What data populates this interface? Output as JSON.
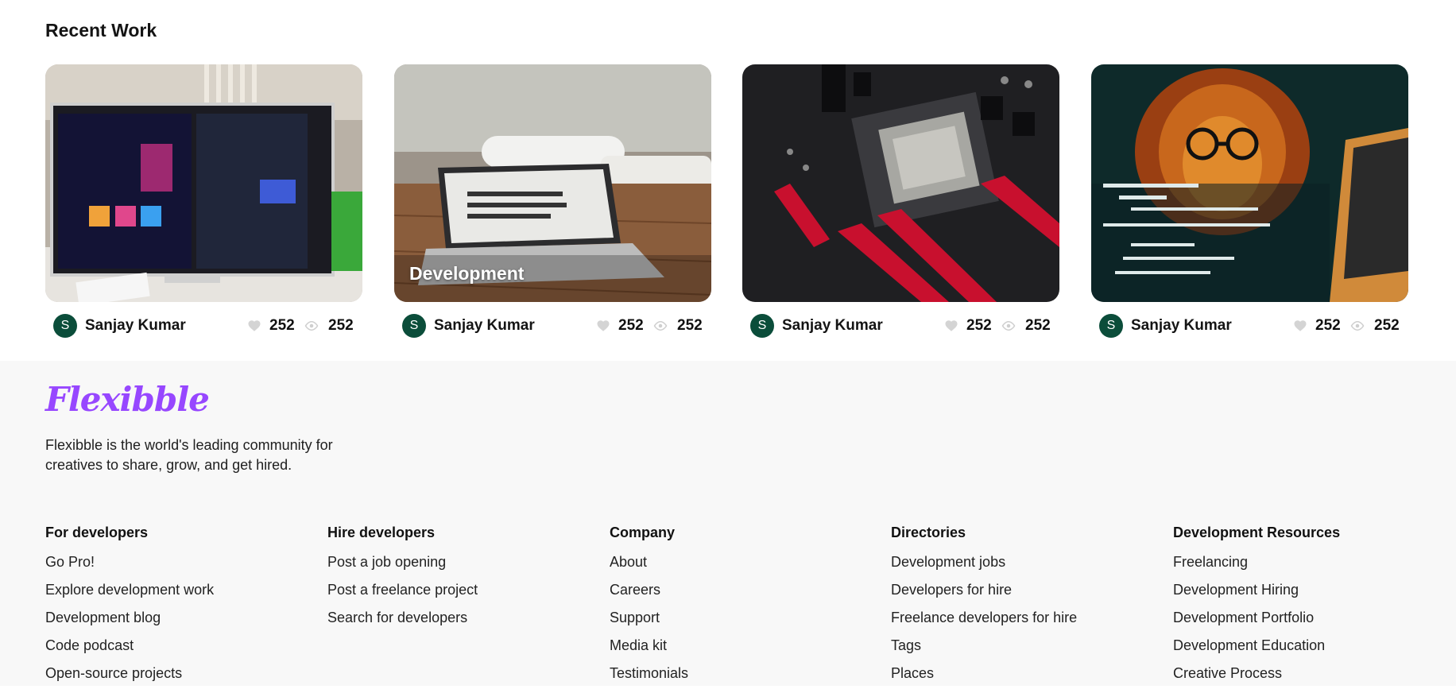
{
  "recent": {
    "title": "Recent Work",
    "cards": [
      {
        "overlay": "",
        "author": "Sanjay Kumar",
        "avatar_initial": "S",
        "likes": "252",
        "views": "252",
        "image": "monitor-design-photo"
      },
      {
        "overlay": "Development",
        "author": "Sanjay Kumar",
        "avatar_initial": "S",
        "likes": "252",
        "views": "252",
        "image": "laptop-desk-photo"
      },
      {
        "overlay": "",
        "author": "Sanjay Kumar",
        "avatar_initial": "S",
        "likes": "252",
        "views": "252",
        "image": "motherboard-photo"
      },
      {
        "overlay": "",
        "author": "Sanjay Kumar",
        "avatar_initial": "S",
        "likes": "252",
        "views": "252",
        "image": "lion-coder-illustration"
      }
    ]
  },
  "footer": {
    "logo": "Flexibble",
    "tagline": "Flexibble is the world's leading community for creatives to share, grow, and get hired.",
    "columns": [
      {
        "title": "For developers",
        "links": [
          "Go Pro!",
          "Explore development work",
          "Development blog",
          "Code podcast",
          "Open-source projects"
        ]
      },
      {
        "title": "Hire developers",
        "links": [
          "Post a job opening",
          "Post a freelance project",
          "Search for developers"
        ]
      },
      {
        "title": "Company",
        "links": [
          "About",
          "Careers",
          "Support",
          "Media kit",
          "Testimonials"
        ]
      },
      {
        "title": "Directories",
        "links": [
          "Development jobs",
          "Developers for hire",
          "Freelance developers for hire",
          "Tags",
          "Places"
        ]
      },
      {
        "title": "Development Resources",
        "links": [
          "Freelancing",
          "Development Hiring",
          "Development Portfolio",
          "Development Education",
          "Creative Process"
        ]
      }
    ]
  },
  "colors": {
    "accent": "#9747ff",
    "avatar": "#0b4d3a",
    "footer_bg": "#f8f8f8"
  }
}
